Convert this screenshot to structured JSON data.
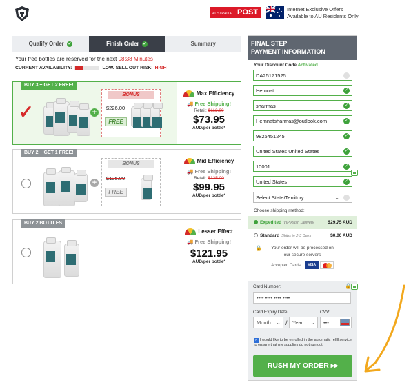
{
  "header": {
    "auspost_small": "AUSTRALIA",
    "auspost_label": "POST",
    "note_line1": "Internet Exclusive Offers",
    "note_line2": "Available to AU Residents Only"
  },
  "steps": [
    {
      "label": "Qualify Order"
    },
    {
      "label": "Finish Order"
    },
    {
      "label": "Summary"
    }
  ],
  "reserve": {
    "text": "Your free bottles are reserved for the next",
    "timer": "08:38 Minutes"
  },
  "availability": {
    "label": "CURRENT AVAILABILITY:",
    "risk_label": "LOW. SELL OUT RISK:",
    "risk_value": "HIGH"
  },
  "packages": [
    {
      "tag": "BUY 3 + GET 2 FREE!",
      "bonus_label": "BONUS",
      "bonus_old_price": "$226.00",
      "bonus_free": "FREE",
      "effect": "Max Efficiency",
      "shipping": "Free Shipping!",
      "retail_label": "Retail:",
      "retail_price": "$113.00",
      "price": "$73.95",
      "per": "AUD/per bottle*"
    },
    {
      "tag": "BUY 2 + GET 1 FREE!",
      "bonus_label": "BONUS",
      "bonus_old_price": "$135.00",
      "bonus_free": "FREE",
      "effect": "Mid Efficiency",
      "shipping": "Free Shipping!",
      "retail_label": "Retail:",
      "retail_price": "$135.00",
      "price": "$99.95",
      "per": "AUD/per bottle*"
    },
    {
      "tag": "BUY 2 BOTTLES",
      "effect": "Lesser Effect",
      "shipping": "Free Shipping!",
      "price": "$121.95",
      "per": "AUD/per bottle*"
    }
  ],
  "form": {
    "title_line1": "FINAL STEP",
    "title_line2": "PAYMENT INFORMATION",
    "discount_label": "Your Discount Code",
    "discount_status": "Activated",
    "discount_code": "DA25171525",
    "first_name": "Hemnat",
    "last_name": "sharmas",
    "email": "Hemnatsharmas@outlook.com",
    "phone": "9825451245",
    "address": "United States United States",
    "zip": "10001",
    "city": "United States",
    "state_placeholder": "Select State/Territory",
    "shipping_label": "Choose shipping method:",
    "shipping_options": [
      {
        "name": "Expedited",
        "note": "VIP Rush Delivery",
        "amount": "$29.75 AUD"
      },
      {
        "name": "Standard",
        "note": "Ships in 2-3 Days",
        "amount": "$0.00 AUD"
      }
    ],
    "secure_line1": "Your order will be processed on",
    "secure_line2": "our secure servers",
    "accepted_cards": "Accepted Cards:",
    "visa": "VISA",
    "card_number_label": "Card Number:",
    "card_number": "•••• •••• •••• ••••",
    "expiry_label": "Card Expiry Date:",
    "cvv_label": "CVV:",
    "month": "Month",
    "year": "Year",
    "cvv": "•••",
    "optin_text": "I would like to be enrolled in the automatic refill service to ensure that my supplies do not run out.",
    "submit": "RUSH MY ORDER ▸▸"
  },
  "colors": {
    "green": "#53b04a",
    "red": "#d42a2a",
    "header_grey": "#5f6670",
    "arrow": "#f2a81d"
  }
}
